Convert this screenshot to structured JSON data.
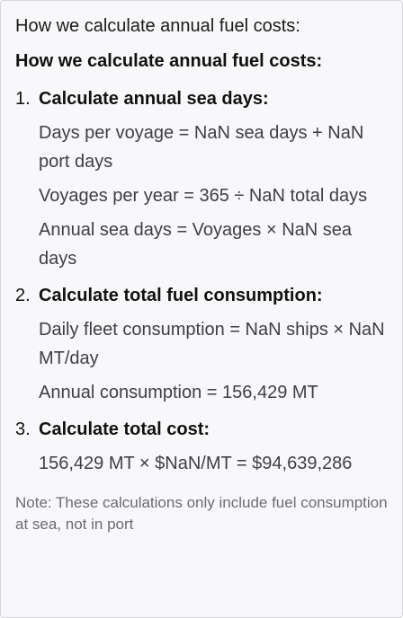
{
  "caption": "How we calculate annual fuel costs:",
  "heading": "How we calculate annual fuel costs:",
  "steps": [
    {
      "number": "1.",
      "title": "Calculate annual sea days:",
      "lines": [
        "Days per voyage = NaN sea days + NaN port days",
        "Voyages per year = 365 ÷ NaN total days",
        "Annual sea days = Voyages × NaN sea days"
      ]
    },
    {
      "number": "2.",
      "title": "Calculate total fuel consumption:",
      "lines": [
        "Daily fleet consumption = NaN ships × NaN MT/day",
        "Annual consumption = 156,429 MT"
      ]
    },
    {
      "number": "3.",
      "title": "Calculate total cost:",
      "lines": [
        "156,429 MT × $NaN/MT = $94,639,286"
      ]
    }
  ],
  "note": "Note: These calculations only include fuel consumption at sea, not in port"
}
